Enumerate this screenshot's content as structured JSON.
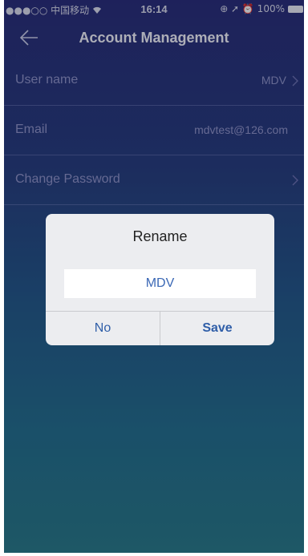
{
  "status_bar": {
    "carrier": "●●●○○ 中国移动 ",
    "time": "16:14",
    "right_status": "⊕ ➚ ⏰ 100%",
    "icons": [
      "wifi-icon",
      "battery-icon"
    ]
  },
  "nav": {
    "title": "Account Management",
    "back_icon": "back-arrow-icon"
  },
  "rows": [
    {
      "label": "User name",
      "value": "MDV",
      "has_arrow": true
    },
    {
      "label": "Email",
      "value": "mdvtest@126.com",
      "has_arrow": false
    },
    {
      "label": "Change Password",
      "value": "",
      "has_arrow": true
    }
  ],
  "dialog": {
    "title": "Rename",
    "input_value": "MDV",
    "buttons": {
      "no": "No",
      "save": "Save"
    }
  },
  "colors": {
    "bg_top": "#2a2f76",
    "bg_bottom": "#2a7a85",
    "row_text": "#8e93c4",
    "dialog_bg": "#ecedf0",
    "accent": "#2f5ea8"
  }
}
